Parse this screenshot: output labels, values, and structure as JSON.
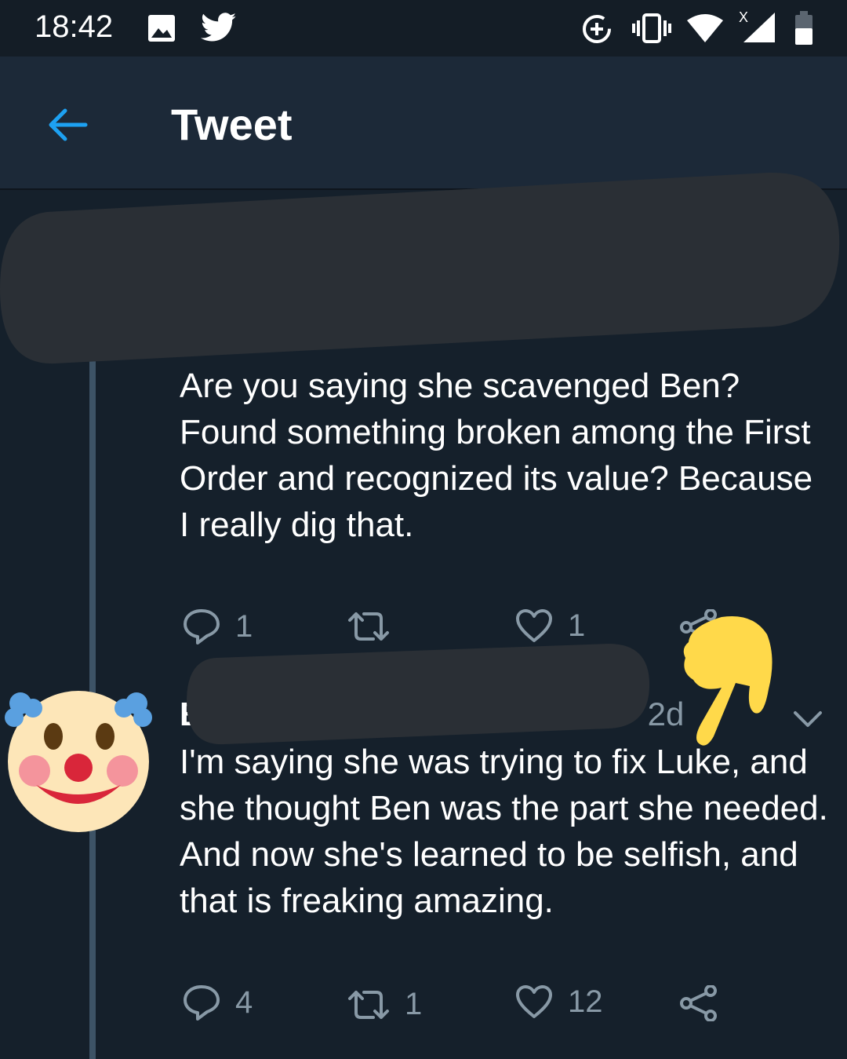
{
  "status_bar": {
    "time": "18:42",
    "icons": [
      "image-icon",
      "twitter-icon",
      "data-saver-icon",
      "vibrate-icon",
      "wifi-icon",
      "signal-icon",
      "battery-icon"
    ]
  },
  "app_bar": {
    "title": "Tweet",
    "back_icon": "arrow-left-icon"
  },
  "tweets": [
    {
      "text": "Are you saying she scavenged Ben? Found something broken among the First Order and recognized its value? Because I really dig that.",
      "replies": "1",
      "retweets": "",
      "likes": "1"
    },
    {
      "author_initial": "B",
      "time": "· 2d",
      "text": "I'm saying she was trying to fix Luke, and she thought Ben was the part she needed. And now she's learned to be selfish, and that is freaking amazing.",
      "replies": "4",
      "retweets": "1",
      "likes": "12"
    }
  ],
  "colors": {
    "background": "#15202b",
    "app_bar": "#1c2938",
    "accent": "#1da1f2",
    "secondary_text": "#8899a6",
    "redaction": "#2a2f35",
    "thread_line": "#3d5366"
  }
}
